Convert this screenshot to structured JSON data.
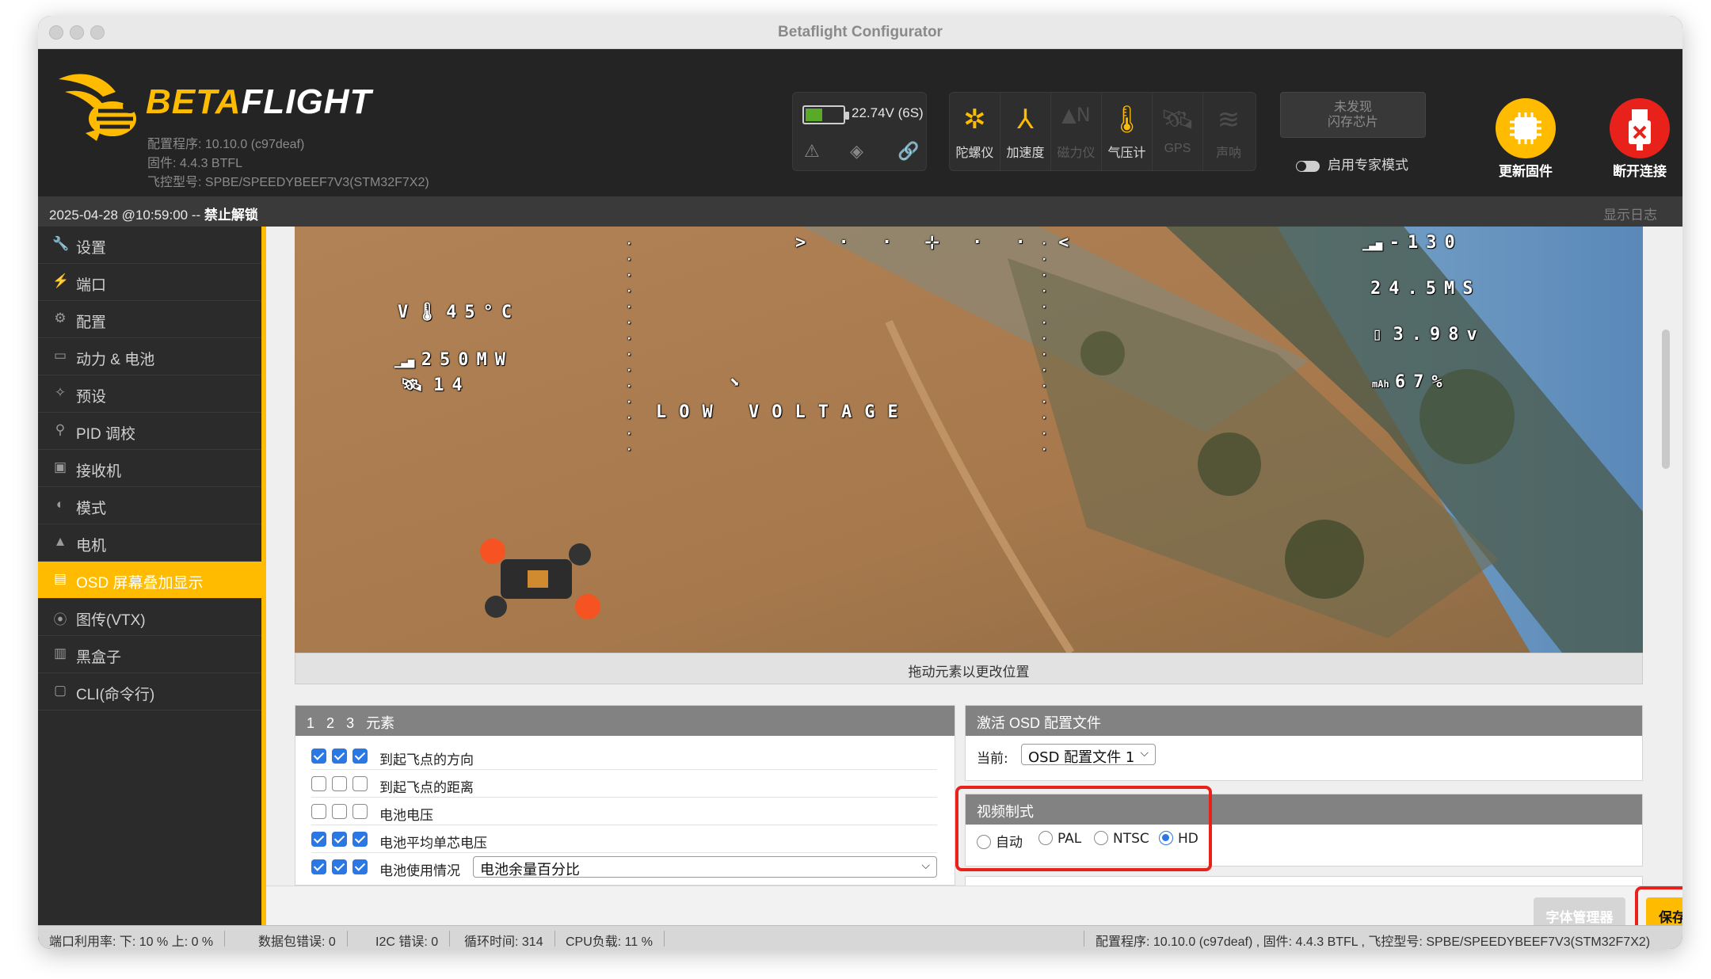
{
  "window": {
    "title": "Betaflight Configurator"
  },
  "header": {
    "logo": {
      "part1": "BETA",
      "part2": "FLIGHT"
    },
    "meta": {
      "configurator": "配置程序: 10.10.0 (c97deaf)",
      "firmware": "固件: 4.4.3 BTFL",
      "board": "飞控型号: SPBE/SPEEDYBEEF7V3(STM32F7X2)"
    },
    "battery": {
      "voltage": "22.74V (6S)",
      "level": 0.45
    },
    "sensors": [
      {
        "label": "陀螺仪",
        "icon": "gyro-icon",
        "active": true
      },
      {
        "label": "加速度",
        "icon": "accelerometer-icon",
        "active": true
      },
      {
        "label": "磁力仪",
        "icon": "magnetometer-icon",
        "active": false
      },
      {
        "label": "气压计",
        "icon": "barometer-icon",
        "active": true
      },
      {
        "label": "GPS",
        "icon": "gps-icon",
        "active": false
      },
      {
        "label": "声呐",
        "icon": "sonar-icon",
        "active": false
      }
    ],
    "flash": {
      "line1": "未发现",
      "line2": "闪存芯片"
    },
    "expert_mode_label": "启用专家模式",
    "update_firmware_label": "更新固件",
    "disconnect_label": "断开连接"
  },
  "status": {
    "datetime": "2025-04-28 @10:59:00 -- ",
    "arming": "禁止解锁",
    "show_log": "显示日志"
  },
  "sidebar": {
    "items": [
      {
        "label": "设置",
        "icon": "wrench-icon"
      },
      {
        "label": "端口",
        "icon": "plug-icon"
      },
      {
        "label": "配置",
        "icon": "gear-icon"
      },
      {
        "label": "动力 & 电池",
        "icon": "battery-icon"
      },
      {
        "label": "预设",
        "icon": "magic-wand-icon"
      },
      {
        "label": "PID 调校",
        "icon": "pid-tree-icon"
      },
      {
        "label": "接收机",
        "icon": "receiver-icon"
      },
      {
        "label": "模式",
        "icon": "toggle-icon"
      },
      {
        "label": "电机",
        "icon": "motor-icon"
      },
      {
        "label": "OSD 屏幕叠加显示",
        "icon": "osd-icon",
        "active": true
      },
      {
        "label": "图传(VTX)",
        "icon": "antenna-icon"
      },
      {
        "label": "黑盒子",
        "icon": "blackbox-icon"
      },
      {
        "label": "CLI(命令行)",
        "icon": "terminal-icon"
      }
    ]
  },
  "osd": {
    "temp": "V🌡45°C",
    "power": "250MW",
    "sats": "14",
    "rssi": "-130",
    "speed": "24.5MS",
    "cell_volt": "3.98v",
    "mah": "67%",
    "warning": "LOW VOLTAGE",
    "drag_hint": "拖动元素以更改位置"
  },
  "elements_panel": {
    "header": {
      "p1": "1",
      "p2": "2",
      "p3": "3",
      "title": "元素"
    },
    "rows": [
      {
        "label": "到起飞点的方向",
        "checks": [
          true,
          true,
          true
        ]
      },
      {
        "label": "到起飞点的距离",
        "checks": [
          false,
          false,
          false
        ]
      },
      {
        "label": "电池电压",
        "checks": [
          false,
          false,
          false
        ]
      },
      {
        "label": "电池平均单芯电压",
        "checks": [
          true,
          true,
          true
        ]
      },
      {
        "label": "电池使用情况",
        "checks": [
          true,
          true,
          true
        ],
        "select": "电池余量百分比"
      }
    ]
  },
  "profile_panel": {
    "title": "激活 OSD 配置文件",
    "current_label": "当前:",
    "current_value": "OSD 配置文件 1"
  },
  "video_panel": {
    "title": "视频制式",
    "options": [
      {
        "label": "自动",
        "selected": false
      },
      {
        "label": "PAL",
        "selected": false
      },
      {
        "label": "NTSC",
        "selected": false
      },
      {
        "label": "HD",
        "selected": true
      }
    ]
  },
  "buttons": {
    "font_manager": "字体管理器",
    "save": "保存"
  },
  "footer": {
    "port_usage": "端口利用率: 下: 10 % 上: 0 %",
    "packet_errors": "数据包错误: 0",
    "i2c_errors": "I2C 错误: 0",
    "cycle_time": "循环时间: 314",
    "cpu_load": "CPU负载: 11 %",
    "version_info": "配置程序: 10.10.0 (c97deaf) , 固件: 4.4.3 BTFL , 飞控型号: SPBE/SPEEDYBEEF7V3(STM32F7X2)"
  }
}
